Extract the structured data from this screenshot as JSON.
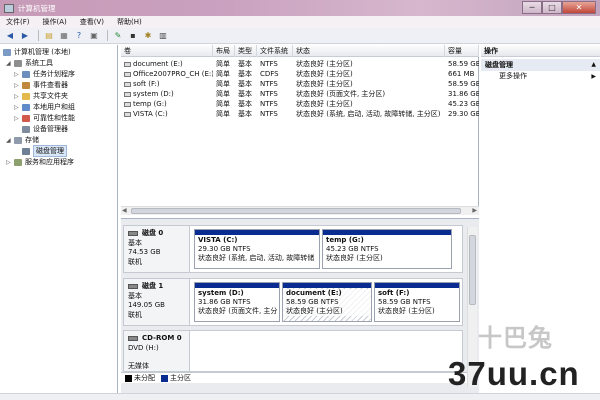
{
  "window": {
    "title": "计算机管理",
    "min": "─",
    "max": "□",
    "close": "✕"
  },
  "menu": [
    "文件(F)",
    "操作(A)",
    "查看(V)",
    "帮助(H)"
  ],
  "toolbar_icons": [
    "back-arrow",
    "forward-arrow",
    "up-folder",
    "show-hide-tree",
    "help",
    "properties",
    "refresh",
    "export",
    "settings",
    "view"
  ],
  "tree": {
    "root": "计算机管理 (本地)",
    "system_tools": "系统工具",
    "task_scheduler": "任务计划程序",
    "event_viewer": "事件查看器",
    "shared_folders": "共享文件夹",
    "local_users": "本地用户和组",
    "performance": "可靠性和性能",
    "device_manager": "设备管理器",
    "storage": "存储",
    "disk_management": "磁盘管理",
    "services": "服务和应用程序"
  },
  "volume_list": {
    "headers": [
      "卷",
      "布局",
      "类型",
      "文件系统",
      "状态",
      "容量"
    ],
    "rows": [
      [
        "document (E:)",
        "简单",
        "基本",
        "NTFS",
        "状态良好 (主分区)",
        "58.59 GB"
      ],
      [
        "Office2007PRO_CH (E:)",
        "简单",
        "基本",
        "CDFS",
        "状态良好 (主分区)",
        "661 MB"
      ],
      [
        "soft (F:)",
        "简单",
        "基本",
        "NTFS",
        "状态良好 (主分区)",
        "58.59 GB"
      ],
      [
        "system (D:)",
        "简单",
        "基本",
        "NTFS",
        "状态良好 (页面文件, 主分区)",
        "31.86 GB"
      ],
      [
        "temp (G:)",
        "简单",
        "基本",
        "NTFS",
        "状态良好 (主分区)",
        "45.23 GB"
      ],
      [
        "VISTA (C:)",
        "简单",
        "基本",
        "NTFS",
        "状态良好 (系统, 启动, 活动, 故障转储, 主分区)",
        "29.30 GB"
      ]
    ]
  },
  "disks": [
    {
      "name": "磁盘 0",
      "type": "基本",
      "size": "74.53 GB",
      "status": "联机",
      "partitions": [
        {
          "name": "VISTA (C:)",
          "size": "29.30 GB NTFS",
          "status": "状态良好 (系统, 启动, 活动, 故障转储"
        },
        {
          "name": "temp (G:)",
          "size": "45.23 GB NTFS",
          "status": "状态良好 (主分区)"
        }
      ]
    },
    {
      "name": "磁盘 1",
      "type": "基本",
      "size": "149.05 GB",
      "status": "联机",
      "partitions": [
        {
          "name": "system (D:)",
          "size": "31.86 GB NTFS",
          "status": "状态良好 (页面文件, 主分"
        },
        {
          "name": "document (E:)",
          "size": "58.59 GB NTFS",
          "status": "状态良好 (主分区)"
        },
        {
          "name": "soft (F:)",
          "size": "58.59 GB NTFS",
          "status": "状态良好 (主分区)"
        }
      ]
    },
    {
      "name": "CD-ROM 0",
      "type": "DVD (H:)",
      "size": "",
      "status": "无媒体",
      "partitions": []
    }
  ],
  "legend": {
    "unallocated": "未分配",
    "primary": "主分区",
    "unallocated_color": "#000000",
    "primary_color": "#0a2b8f"
  },
  "actions": {
    "header": "操作",
    "section": "磁盘管理",
    "more": "更多操作",
    "up_arrow": "▲",
    "right_arrow": "▶"
  },
  "watermark": {
    "top": "十巴兔",
    "bottom": "37uu.cn"
  }
}
